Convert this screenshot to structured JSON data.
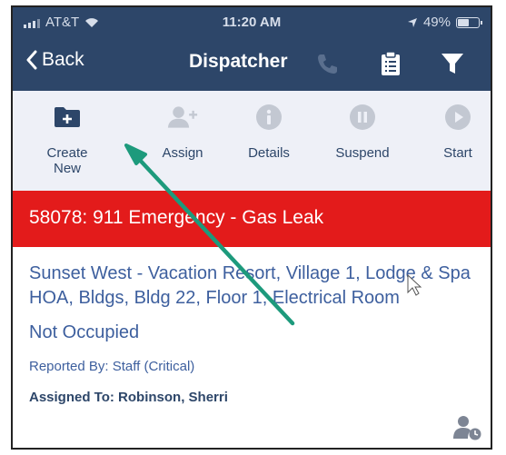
{
  "status_bar": {
    "carrier": "AT&T",
    "time": "11:20 AM",
    "battery": "49%",
    "battery_level": 0.49
  },
  "nav": {
    "back_label": "Back",
    "title": "Dispatcher"
  },
  "actions": [
    {
      "label": "Create New",
      "icon": "folder-plus-icon",
      "enabled": true
    },
    {
      "label": "Assign",
      "icon": "add-user-icon",
      "enabled": false
    },
    {
      "label": "Details",
      "icon": "info-icon",
      "enabled": false
    },
    {
      "label": "Suspend",
      "icon": "pause-icon",
      "enabled": false
    },
    {
      "label": "Start",
      "icon": "play-icon",
      "enabled": false
    }
  ],
  "work_order": {
    "title": "58078: 911 Emergency - Gas Leak",
    "location": "Sunset West - Vacation Resort, Village 1, Lodge & Spa HOA, Bldgs, Bldg 22, Floor 1, Electrical Room",
    "occupancy": "Not Occupied",
    "reported_by": "Reported By: Staff  (Critical)",
    "assigned_to": "Assigned To: Robinson, Sherri"
  },
  "colors": {
    "nav_background": "#2d4669",
    "banner": "#e31b1b",
    "link_text": "#3d5f9e",
    "annotation_arrow": "#1d9a7c"
  }
}
